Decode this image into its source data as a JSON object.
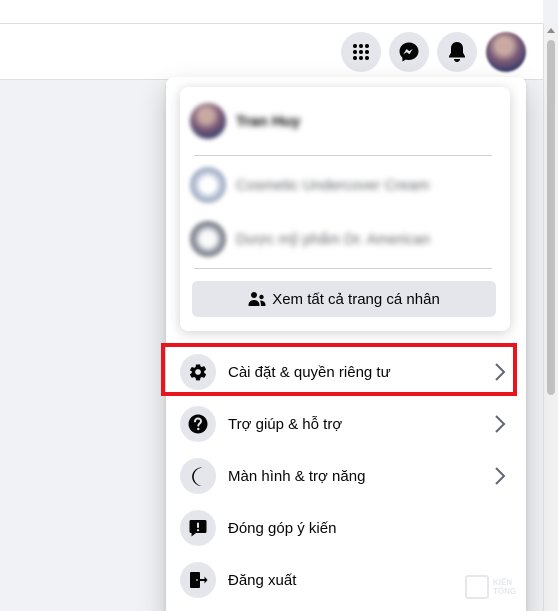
{
  "topbar": {
    "icons": [
      "menu-grid-icon",
      "messenger-icon",
      "bell-icon",
      "avatar"
    ]
  },
  "account_menu": {
    "profile_name": "Tran Huy",
    "pages": [
      {
        "name": "Cosmetic Undercover Cream"
      },
      {
        "name": "Dược mỹ phẩm Dr. American"
      }
    ],
    "see_all_label": "Xem tất cả trang cá nhân"
  },
  "menu": {
    "items": [
      {
        "label": "Cài đặt & quyền riêng tư",
        "icon": "gear-icon",
        "has_arrow": true
      },
      {
        "label": "Trợ giúp & hỗ trợ",
        "icon": "help-icon",
        "has_arrow": true
      },
      {
        "label": "Màn hình & trợ năng",
        "icon": "moon-icon",
        "has_arrow": true
      },
      {
        "label": "Đóng góp ý kiến",
        "icon": "feedback-icon",
        "has_arrow": false
      },
      {
        "label": "Đăng xuất",
        "icon": "logout-icon",
        "has_arrow": false
      }
    ]
  },
  "watermark": {
    "line1": "KIẾN",
    "line2": "TỔNG"
  },
  "colors": {
    "highlight_border": "#e8141e",
    "icon_bg": "#e4e6eb",
    "page_bg": "#f0f2f5"
  }
}
